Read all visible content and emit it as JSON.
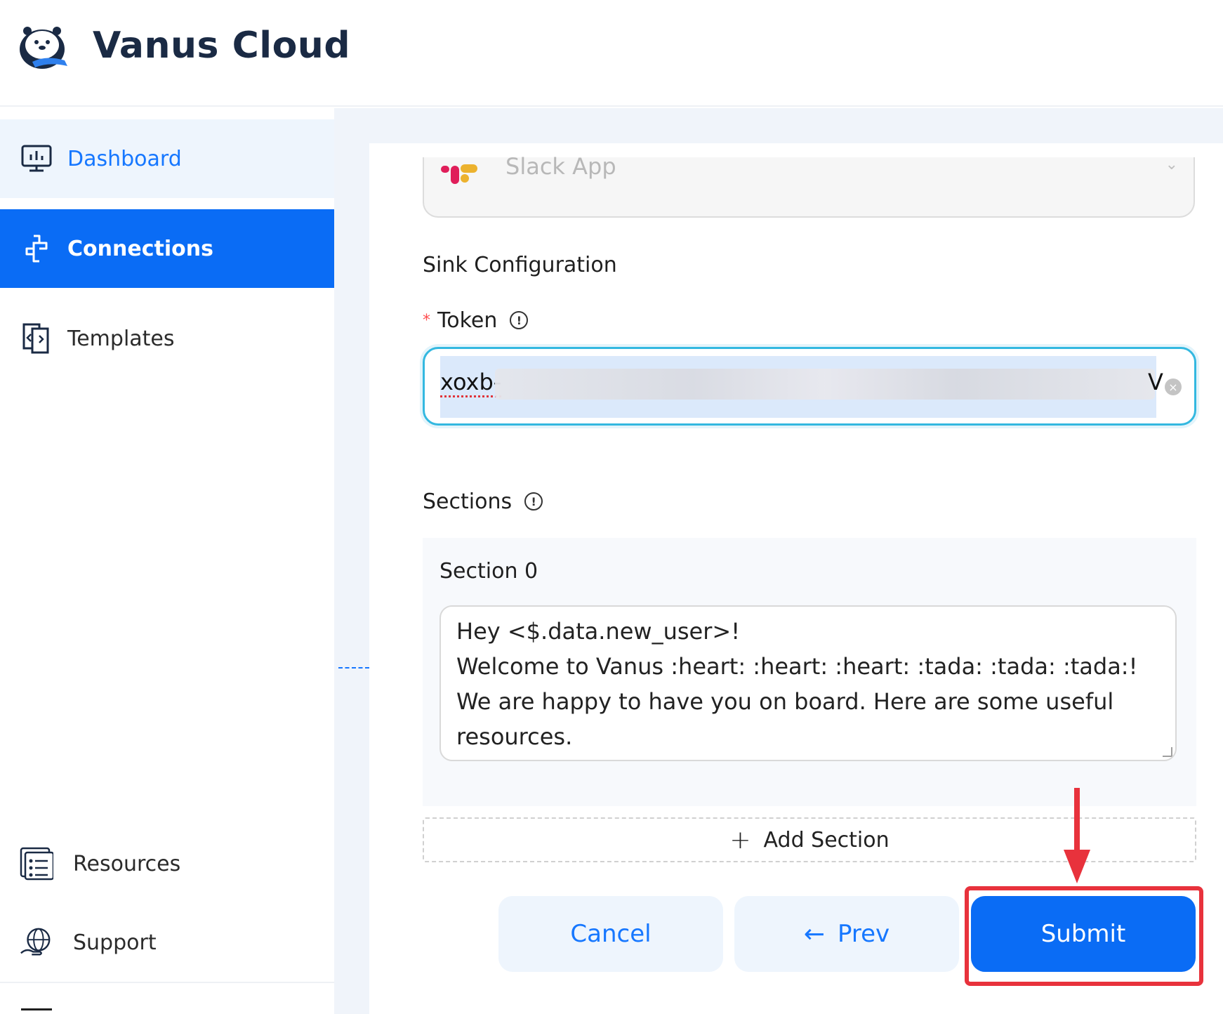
{
  "app": {
    "brand": "Vanus Cloud"
  },
  "sidebar": {
    "items": [
      {
        "label": "Dashboard",
        "icon": "dashboard-icon"
      },
      {
        "label": "Connections",
        "icon": "connections-icon"
      },
      {
        "label": "Templates",
        "icon": "templates-icon"
      }
    ],
    "bottom_items": [
      {
        "label": "Resources",
        "icon": "resources-icon"
      },
      {
        "label": "Support",
        "icon": "support-icon"
      }
    ],
    "active": "Connections"
  },
  "form": {
    "sink_select": {
      "value": "Slack App",
      "icon": "slack-icon"
    },
    "sink_config_title": "Sink Configuration",
    "token": {
      "label": "Token",
      "required": "*",
      "value_prefix": "xoxb-",
      "value_suffix": "V"
    },
    "sections": {
      "label": "Sections",
      "items": [
        {
          "title": "Section 0",
          "lines": [
            "Hey <$.data.new_user>!",
            "Welcome to Vanus :heart: :heart: :heart: :tada: :tada: :tada:!",
            "We are happy to have you on board. Here are some useful",
            "resources."
          ]
        }
      ],
      "add_label": "Add Section"
    },
    "buttons": {
      "cancel": "Cancel",
      "prev": "Prev",
      "submit": "Submit"
    }
  },
  "colors": {
    "primary": "#0a6cf5",
    "active_bg": "#0a6cf5",
    "highlight": "#e8323c",
    "focus_border": "#33b8e0"
  }
}
